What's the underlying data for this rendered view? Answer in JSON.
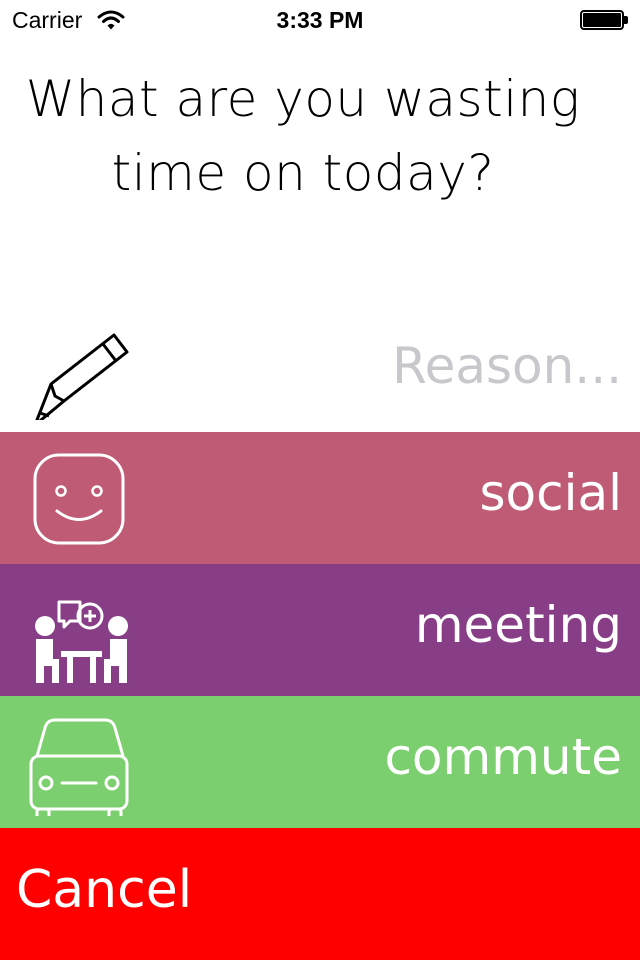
{
  "status_bar": {
    "carrier": "Carrier",
    "time": "3:33 PM"
  },
  "prompt": {
    "line1": "What are you wasting",
    "line2": "time on today?"
  },
  "reason_input": {
    "placeholder": "Reason...",
    "value": "",
    "icon": "pencil-icon"
  },
  "categories": [
    {
      "label": "social",
      "icon": "smiley-face-icon",
      "color": "#c05b75"
    },
    {
      "label": "meeting",
      "icon": "meeting-people-icon",
      "color": "#883e86"
    },
    {
      "label": "commute",
      "icon": "car-icon",
      "color": "#7ccf6e"
    }
  ],
  "cancel": {
    "label": "Cancel",
    "color": "#ff0000"
  }
}
